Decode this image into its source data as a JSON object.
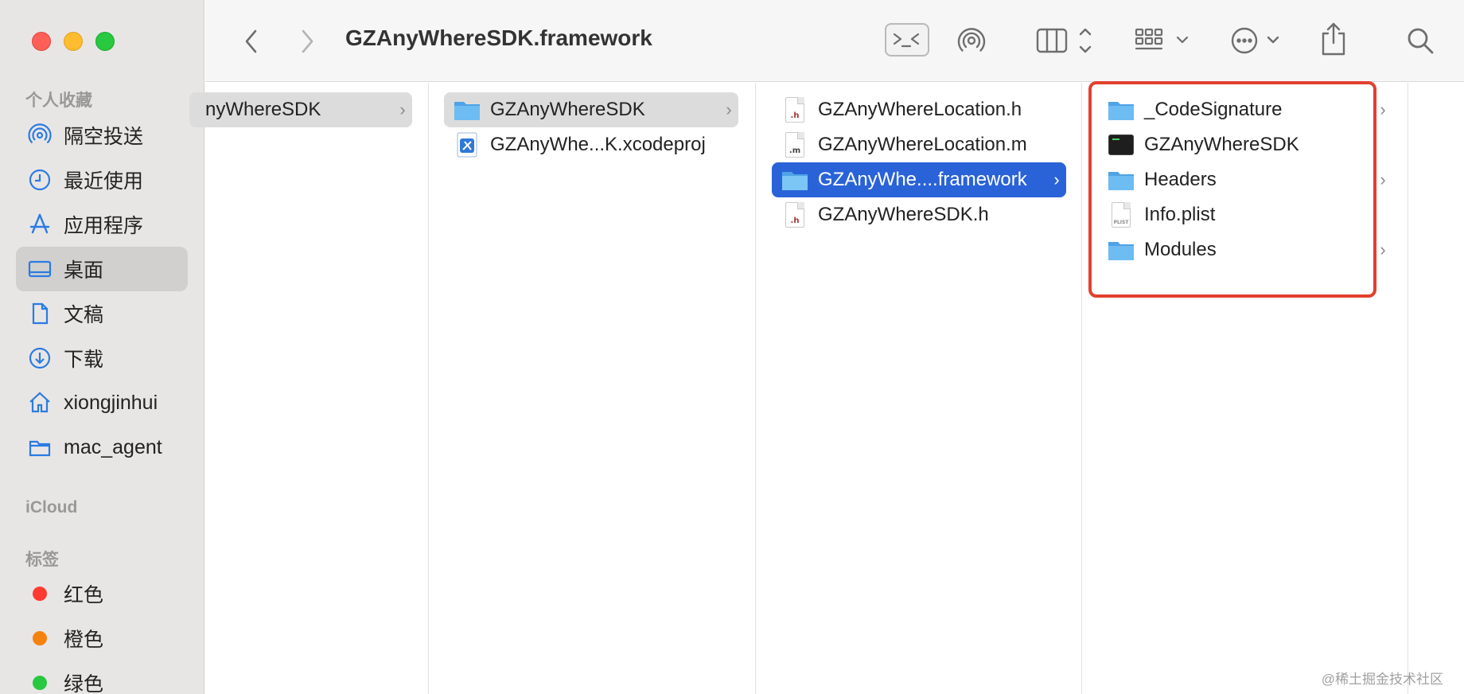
{
  "window": {
    "title": "GZAnyWhereSDK.framework"
  },
  "sidebar": {
    "favorites_header": "个人收藏",
    "favorites": [
      {
        "label": "隔空投送",
        "icon": "airdrop-icon"
      },
      {
        "label": "最近使用",
        "icon": "clock-icon"
      },
      {
        "label": "应用程序",
        "icon": "applications-icon"
      },
      {
        "label": "桌面",
        "icon": "desktop-icon",
        "selected": true
      },
      {
        "label": "文稿",
        "icon": "document-icon"
      },
      {
        "label": "下载",
        "icon": "download-icon"
      },
      {
        "label": "xiongjinhui",
        "icon": "home-icon"
      },
      {
        "label": "mac_agent",
        "icon": "folder-icon"
      }
    ],
    "icloud_header": "iCloud",
    "tags_header": "标签",
    "tags": [
      {
        "label": "红色",
        "color": "#fe3b30"
      },
      {
        "label": "橙色",
        "color": "#f5820d"
      },
      {
        "label": "绿色",
        "color": "#28c840"
      }
    ]
  },
  "toolbar": {
    "back": "back-chevron-icon",
    "forward": "forward-chevron-icon",
    "terminal": "terminal-icon",
    "airdrop": "airdrop-icon",
    "view_columns": "columns-view-icon",
    "group": "grid-group-icon",
    "more": "more-options-icon",
    "share": "share-icon",
    "search": "search-icon"
  },
  "columns": [
    {
      "items": [
        {
          "label": "nyWhereSDK",
          "type": "folder",
          "state": "gray",
          "chevron": "›"
        }
      ]
    },
    {
      "items": [
        {
          "label": "GZAnyWhereSDK",
          "type": "folder",
          "state": "gray",
          "chevron": "›"
        },
        {
          "label": "GZAnyWhe...K.xcodeproj",
          "type": "xcodeproj"
        }
      ]
    },
    {
      "items": [
        {
          "label": "GZAnyWhereLocation.h",
          "type": "h",
          "badge": ".h"
        },
        {
          "label": "GZAnyWhereLocation.m",
          "type": "m",
          "badge": ".m"
        },
        {
          "label": "GZAnyWhe....framework",
          "type": "folder",
          "state": "blue",
          "chevron": "›"
        },
        {
          "label": "GZAnyWhereSDK.h",
          "type": "h",
          "badge": ".h"
        }
      ]
    },
    {
      "items": [
        {
          "label": "_CodeSignature",
          "type": "folder",
          "chevron": "›"
        },
        {
          "label": "GZAnyWhereSDK",
          "type": "exec"
        },
        {
          "label": "Headers",
          "type": "folder",
          "chevron": "›"
        },
        {
          "label": "Info.plist",
          "type": "plist",
          "badge": "PLIST"
        },
        {
          "label": "Modules",
          "type": "folder",
          "chevron": "›"
        }
      ]
    }
  ],
  "watermark": "@稀土掘金技术社区",
  "colors": {
    "selection_blue": "#2a63d8",
    "highlight_red": "#e2402f",
    "folder_blue": "#5ab0ef"
  }
}
